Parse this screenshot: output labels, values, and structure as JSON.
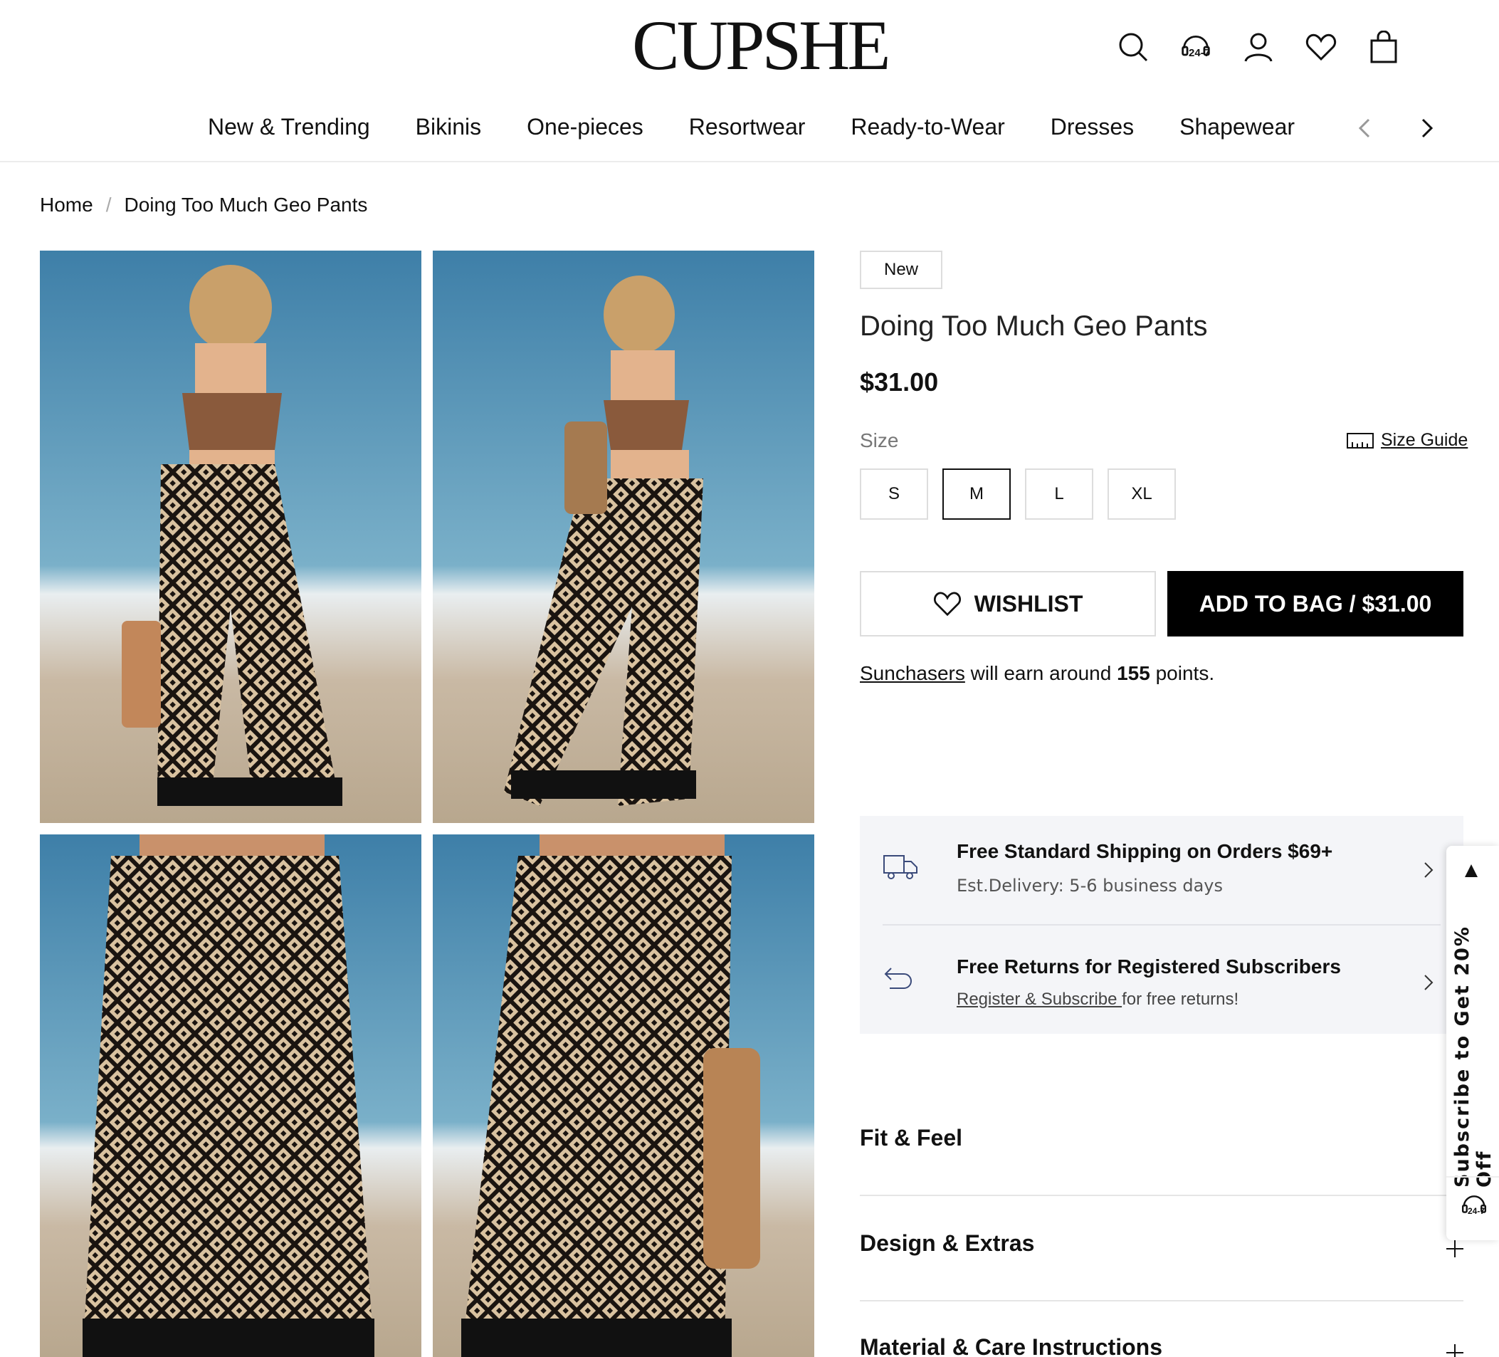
{
  "brand": {
    "logo_text": "CUPSHE"
  },
  "header": {
    "icons": [
      "search-icon",
      "support-24-7-icon",
      "account-icon",
      "wishlist-heart-icon",
      "shopping-bag-icon"
    ],
    "support_badge": "24-7"
  },
  "nav": {
    "items": [
      "New & Trending",
      "Bikinis",
      "One-pieces",
      "Resortwear",
      "Ready-to-Wear",
      "Dresses",
      "Shapewear"
    ]
  },
  "breadcrumb": {
    "home": "Home",
    "separator": "/",
    "current": "Doing Too Much Geo Pants"
  },
  "product": {
    "badge": "New",
    "title": "Doing Too Much Geo Pants",
    "price": "$31.00",
    "size_label": "Size",
    "size_guide": "Size Guide",
    "sizes": [
      "S",
      "M",
      "L",
      "XL"
    ],
    "selected_size": "M",
    "wishlist_label": "WISHLIST",
    "add_to_bag_label": "ADD TO BAG / $31.00"
  },
  "points": {
    "link": "Sunchasers",
    "middle": " will earn around ",
    "value": "155",
    "suffix": " points."
  },
  "shipping": {
    "title": "Free Standard Shipping on Orders $69+",
    "subtitle": "Est.Delivery: 5-6 business days"
  },
  "returns": {
    "title": "Free Returns for Registered Subscribers",
    "link": "Register & Subscribe ",
    "suffix": "for free returns!"
  },
  "accordion": [
    "Fit & Feel",
    "Design & Extras",
    "Material & Care Instructions"
  ],
  "side_tab": {
    "text": "Subscribe to Get 20% Off",
    "support_badge": "24-7"
  },
  "colors": {
    "accent": "#000000",
    "panel": "#f4f5f8",
    "border": "#dddddd"
  }
}
